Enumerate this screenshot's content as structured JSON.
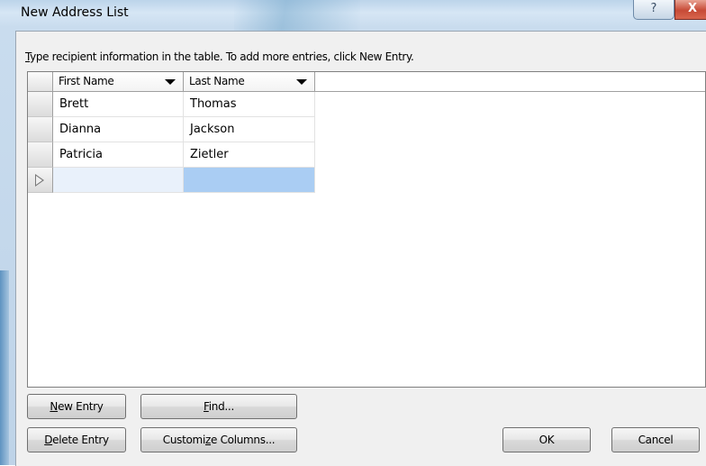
{
  "window": {
    "title": "New Address List",
    "help_glyph": "?",
    "close_glyph": "X"
  },
  "instruction": {
    "first_letter": "T",
    "rest": "ype recipient information in the table.  To add more entries, click New Entry."
  },
  "table": {
    "columns": [
      {
        "label": "First Name"
      },
      {
        "label": "Last Name"
      }
    ],
    "rows": [
      {
        "first": "Brett",
        "last": "Thomas"
      },
      {
        "first": "Dianna",
        "last": "Jackson"
      },
      {
        "first": "Patricia",
        "last": "Zietler"
      },
      {
        "first": "",
        "last": ""
      }
    ]
  },
  "buttons": {
    "new_entry": {
      "accel": "N",
      "rest": "ew Entry"
    },
    "find": {
      "accel": "F",
      "rest": "ind..."
    },
    "delete_entry": {
      "accel": "D",
      "rest": "elete Entry"
    },
    "customize": {
      "pre": "Customi",
      "accel": "z",
      "post": "e Columns..."
    },
    "ok": "OK",
    "cancel": "Cancel"
  }
}
